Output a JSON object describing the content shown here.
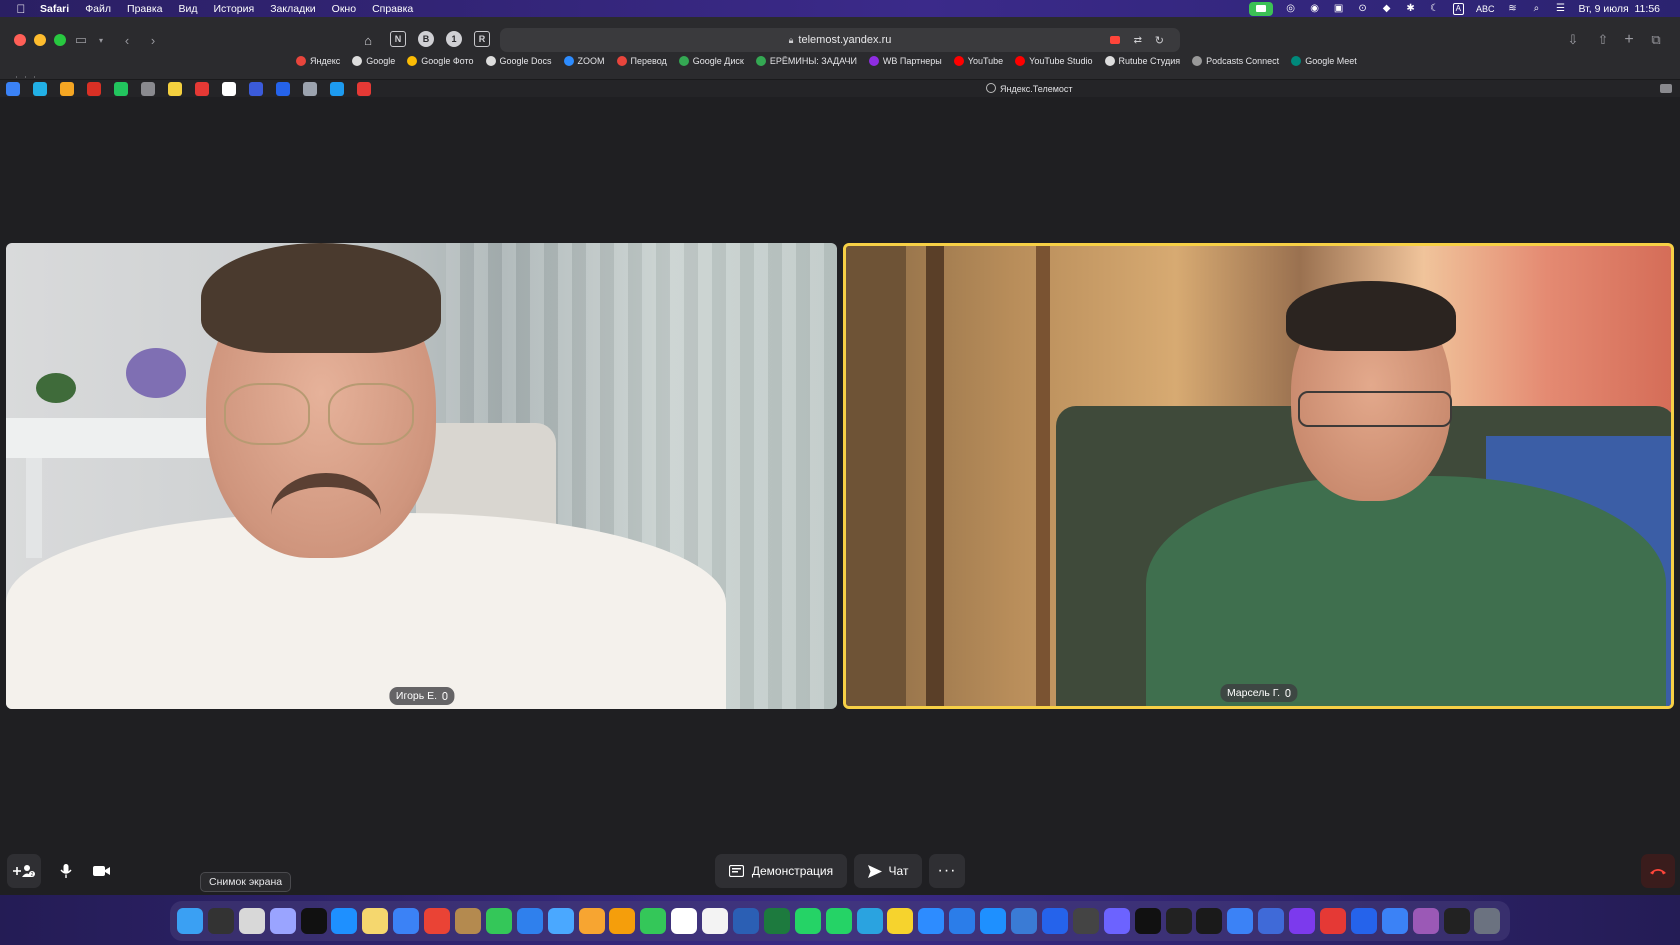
{
  "menubar": {
    "app": "Safari",
    "items": [
      "Файл",
      "Правка",
      "Вид",
      "История",
      "Закладки",
      "Окно",
      "Справка"
    ],
    "input_source": "ABC",
    "datetime": "Вт, 9 июля  11:56"
  },
  "browser": {
    "url": "telemost.yandex.ru",
    "tab_title": "Яндекс.Телемост",
    "bookmarks": [
      {
        "label": "Яндекс",
        "color": "#e8453c"
      },
      {
        "label": "Google",
        "color": "#dddddd"
      },
      {
        "label": "Google Фото",
        "color": "#fbbc05"
      },
      {
        "label": "Google Docs",
        "color": "#dddddd"
      },
      {
        "label": "ZOOM",
        "color": "#2d8cff"
      },
      {
        "label": "Перевод",
        "color": "#e8453c"
      },
      {
        "label": "Google Диск",
        "color": "#34a853"
      },
      {
        "label": "ЕРЁМИНЫ: ЗАДАЧИ",
        "color": "#34a853"
      },
      {
        "label": "WB Партнеры",
        "color": "#8e2de2"
      },
      {
        "label": "YouTube",
        "color": "#ff0000"
      },
      {
        "label": "YouTube Studio",
        "color": "#ff0000"
      },
      {
        "label": "Rutube Студия",
        "color": "#dddddd"
      },
      {
        "label": "Podcasts Connect",
        "color": "#999999"
      },
      {
        "label": "Google Meet",
        "color": "#00897b"
      }
    ],
    "pinned_tab_colors": [
      "#3b82f6",
      "#22b0e6",
      "#f5a623",
      "#d93025",
      "#22c55e",
      "#8a8a8f",
      "#f4d03f",
      "#e53935",
      "#ffffff",
      "#3b5bdb",
      "#2563eb",
      "#9ca3af",
      "#1d9bf0",
      "#e53935"
    ]
  },
  "call": {
    "participants": [
      {
        "name": "Игорь Е."
      },
      {
        "name": "Марсель Г."
      }
    ],
    "controls": {
      "demo": "Демонстрация",
      "chat": "Чат",
      "more": "···"
    },
    "tooltip": "Снимок экрана",
    "active_speaker_color": "#f7d046"
  },
  "dock": {
    "icon_colors": [
      "#3aa0f3",
      "#333333",
      "#d8d8d8",
      "#9aa4ff",
      "#111111",
      "#1e90ff",
      "#f5d76e",
      "#3b82f6",
      "#ea4335",
      "#b48a4f",
      "#34c759",
      "#2f80ed",
      "#4aa8ff",
      "#f7a531",
      "#f59e0b",
      "#34c759",
      "#ffffff",
      "#f3f3f3",
      "#2b5fb4",
      "#1d7a3e",
      "#25d366",
      "#25d366",
      "#2aa3e0",
      "#f6d32d",
      "#2d8cff",
      "#2b7de9",
      "#1e90ff",
      "#3a7bd5",
      "#2563eb",
      "#444444",
      "#6c63ff",
      "#111111",
      "#222222",
      "#1a1a1a",
      "#3b82f6",
      "#3f6ad8",
      "#7c3aed",
      "#e53935",
      "#2563eb",
      "#3b82f6",
      "#9b59b6",
      "#222222",
      "#6b7280"
    ]
  }
}
